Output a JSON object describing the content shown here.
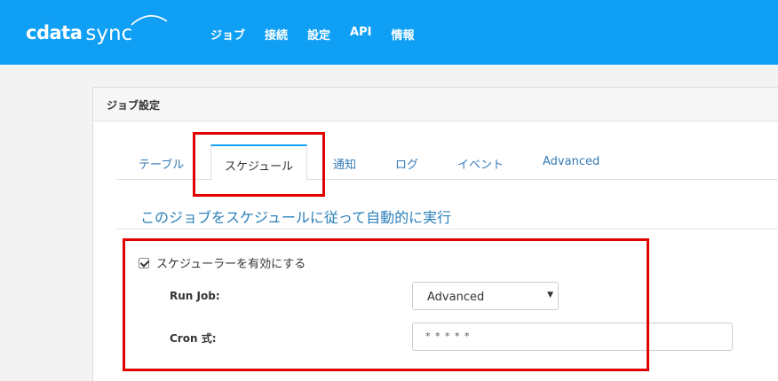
{
  "brand": {
    "cdata": "cdata",
    "sync": "sync",
    "color": "#0f9ff5"
  },
  "nav": [
    "ジョブ",
    "接続",
    "設定",
    "API",
    "情報"
  ],
  "panel": {
    "title": "ジョブ設定"
  },
  "tabs": [
    {
      "label": "テーブル",
      "active": false
    },
    {
      "label": "スケジュール",
      "active": true
    },
    {
      "label": "通知",
      "active": false
    },
    {
      "label": "ログ",
      "active": false
    },
    {
      "label": "イベント",
      "active": false
    },
    {
      "label": "Advanced",
      "active": false
    }
  ],
  "schedule": {
    "heading": "このジョブをスケジュールに従って自動的に実行",
    "enable_label": "スケジューラーを有効にする",
    "enabled": true,
    "run_job_label": "Run Job:",
    "run_job_value": "Advanced",
    "cron_label": "Cron 式:",
    "cron_value": "* * * * *"
  },
  "highlight_color": "#e00000"
}
